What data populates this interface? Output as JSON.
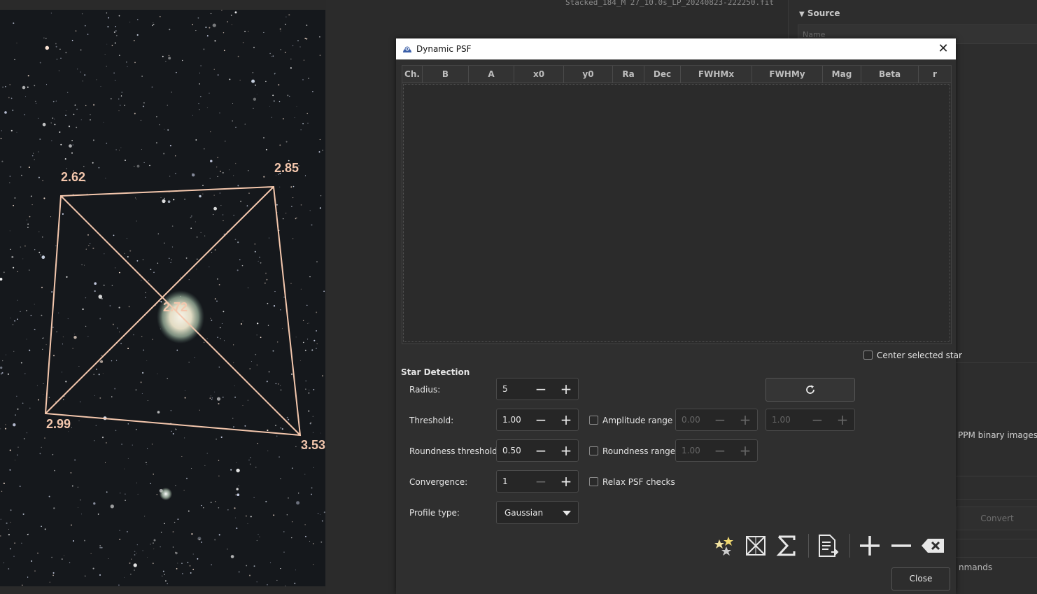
{
  "image": {
    "filename": "Stacked_184_M 27_10.0s_LP_20240823-222250.fit",
    "fwhm_labels": [
      "2.62",
      "2.85",
      "2.72",
      "2.99",
      "3.53"
    ]
  },
  "right_panel": {
    "source_label": "Source",
    "name_placeholder": "Name",
    "ppm_text": "PPM binary images, R",
    "convert_label": "Convert",
    "commands_text": "nmands"
  },
  "dialog": {
    "title": "Dynamic PSF",
    "columns": [
      "Ch.",
      "B",
      "A",
      "x0",
      "y0",
      "Ra",
      "Dec",
      "FWHMx",
      "FWHMy",
      "Mag",
      "Beta",
      "r"
    ],
    "center_selected_star_label": "Center selected star",
    "center_selected_star_checked": false,
    "section_title": "Star Detection",
    "radius": {
      "label": "Radius:",
      "value": "5"
    },
    "threshold": {
      "label": "Threshold:",
      "value": "1.00"
    },
    "roundness_threshold": {
      "label": "Roundness threshold:",
      "value": "0.50"
    },
    "convergence": {
      "label": "Convergence:",
      "value": "1"
    },
    "profile_type": {
      "label": "Profile type:",
      "value": "Gaussian"
    },
    "amplitude_range": {
      "label": "Amplitude range",
      "checked": false,
      "min": "0.00",
      "max": "1.00"
    },
    "roundness_range": {
      "label": "Roundness range",
      "checked": false,
      "value": "1.00"
    },
    "relax_psf": {
      "label": "Relax PSF checks",
      "checked": false
    },
    "close_label": "Close"
  },
  "colors": {
    "dialog_bg": "#2f2f2f",
    "fwhm_overlay": "#f4c7ad",
    "titlebar": "#ffffff"
  },
  "icons": [
    "dynamic-psf-app-icon",
    "close-icon",
    "refresh-icon",
    "find-stars-icon",
    "mirror-icon",
    "sum-icon",
    "export-list-icon",
    "add-star-icon",
    "remove-star-icon",
    "clear-all-icon",
    "chevron-down-icon"
  ]
}
